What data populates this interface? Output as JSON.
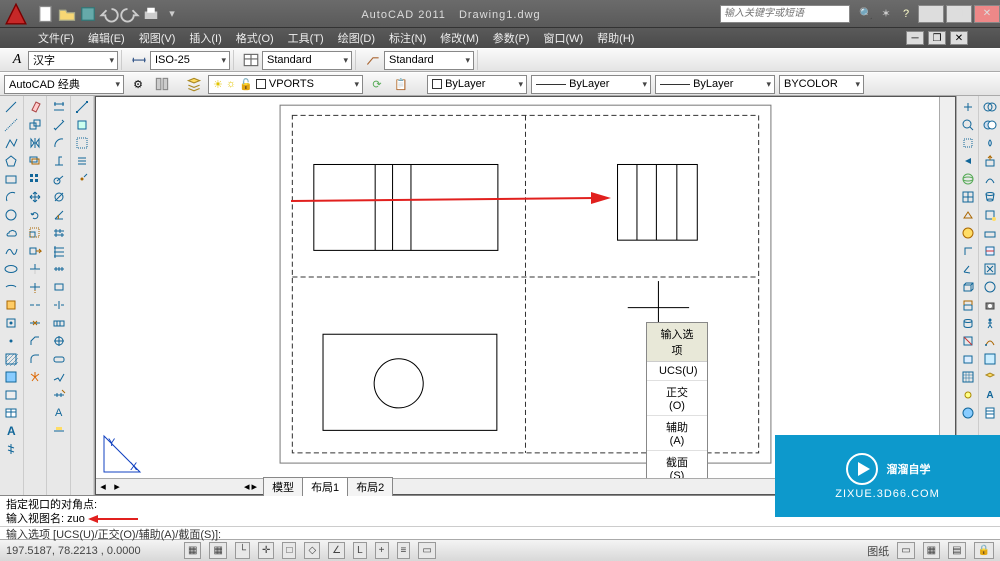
{
  "title": {
    "app": "AutoCAD 2011",
    "doc": "Drawing1.dwg"
  },
  "search_placeholder": "输入关键字或短语",
  "menus": [
    "文件(F)",
    "编辑(E)",
    "视图(V)",
    "插入(I)",
    "格式(O)",
    "工具(T)",
    "绘图(D)",
    "标注(N)",
    "修改(M)",
    "参数(P)",
    "窗口(W)",
    "帮助(H)"
  ],
  "tb1": {
    "text_style": "A",
    "ime": "汉字",
    "dim_style": "ISO-25",
    "std1": "Standard",
    "std2": "Standard"
  },
  "tb2": {
    "workspace": "AutoCAD 经典",
    "layer_state": "VPORTS",
    "bylayer": "ByLayer",
    "bylayer_lt": "ByLayer",
    "bylayer_lw": "ByLayer",
    "bycolor": "BYCOLOR"
  },
  "tabs": [
    "模型",
    "布局1",
    "布局2"
  ],
  "cmd": {
    "line1": "指定视口的对角点:",
    "line2_label": "输入视图名: ",
    "line2_value": "zuo",
    "prompt": "输入选项 [UCS(U)/正交(O)/辅助(A)/截面(S)]:"
  },
  "status": {
    "coords": "197.5187,   78.2213 , 0.0000",
    "paper": "图纸"
  },
  "opt_menu": {
    "header": "输入选项",
    "items": [
      "UCS(U)",
      "正交(O)",
      "辅助(A)",
      "截面(S)"
    ]
  },
  "watermark": {
    "brand": "溜溜自学",
    "url": "ZIXUE.3D66.COM"
  }
}
